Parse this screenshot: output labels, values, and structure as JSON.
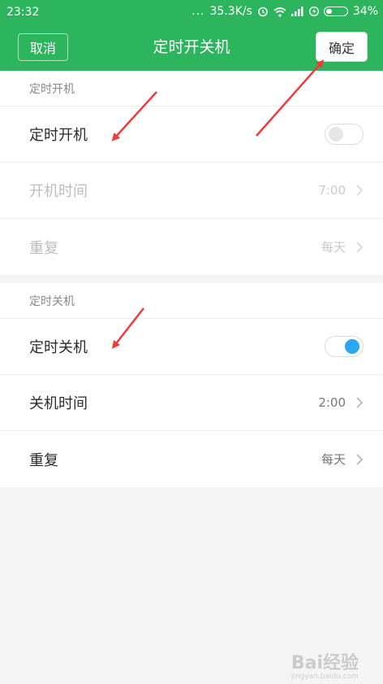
{
  "status_bar": {
    "time": "23:32",
    "dots": "...",
    "network_speed": "35.3K/s",
    "battery_percent": "34%",
    "battery_level": 0.34,
    "icons": [
      "alarm-icon",
      "wifi-icon",
      "signal-icon",
      "charging-icon",
      "battery-icon"
    ]
  },
  "header": {
    "cancel_label": "取消",
    "title": "定时开关机",
    "confirm_label": "确定",
    "bg_color": "#2db55d"
  },
  "power_on": {
    "section_title": "定时开机",
    "toggle_label": "定时开机",
    "toggle_on": false,
    "time_label": "开机时间",
    "time_value": "7:00",
    "repeat_label": "重复",
    "repeat_value": "每天"
  },
  "power_off": {
    "section_title": "定时关机",
    "toggle_label": "定时关机",
    "toggle_on": true,
    "toggle_color": "#2aa6f2",
    "time_label": "关机时间",
    "time_value": "2:00",
    "repeat_label": "重复",
    "repeat_value": "每天"
  },
  "annotations": {
    "arrow_color": "#ee3b3b"
  },
  "watermark": {
    "text": "Bai经验",
    "sub": "jingyan.baidu.com"
  }
}
